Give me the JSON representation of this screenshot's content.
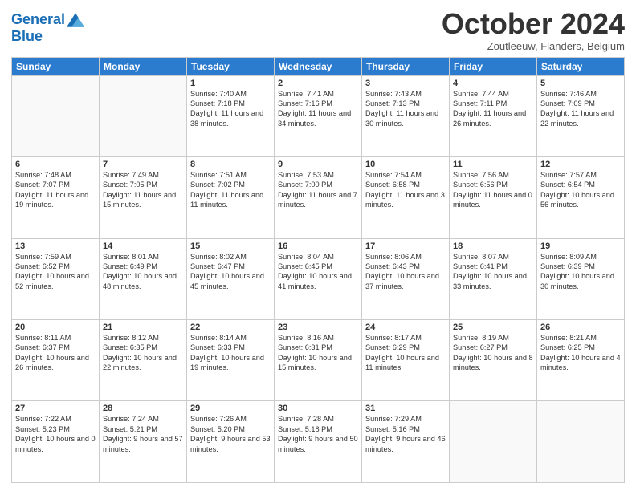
{
  "logo": {
    "line1": "General",
    "line2": "Blue"
  },
  "title": "October 2024",
  "subtitle": "Zoutleeuw, Flanders, Belgium",
  "days_of_week": [
    "Sunday",
    "Monday",
    "Tuesday",
    "Wednesday",
    "Thursday",
    "Friday",
    "Saturday"
  ],
  "weeks": [
    [
      {
        "day": "",
        "info": ""
      },
      {
        "day": "",
        "info": ""
      },
      {
        "day": "1",
        "info": "Sunrise: 7:40 AM\nSunset: 7:18 PM\nDaylight: 11 hours and 38 minutes."
      },
      {
        "day": "2",
        "info": "Sunrise: 7:41 AM\nSunset: 7:16 PM\nDaylight: 11 hours and 34 minutes."
      },
      {
        "day": "3",
        "info": "Sunrise: 7:43 AM\nSunset: 7:13 PM\nDaylight: 11 hours and 30 minutes."
      },
      {
        "day": "4",
        "info": "Sunrise: 7:44 AM\nSunset: 7:11 PM\nDaylight: 11 hours and 26 minutes."
      },
      {
        "day": "5",
        "info": "Sunrise: 7:46 AM\nSunset: 7:09 PM\nDaylight: 11 hours and 22 minutes."
      }
    ],
    [
      {
        "day": "6",
        "info": "Sunrise: 7:48 AM\nSunset: 7:07 PM\nDaylight: 11 hours and 19 minutes."
      },
      {
        "day": "7",
        "info": "Sunrise: 7:49 AM\nSunset: 7:05 PM\nDaylight: 11 hours and 15 minutes."
      },
      {
        "day": "8",
        "info": "Sunrise: 7:51 AM\nSunset: 7:02 PM\nDaylight: 11 hours and 11 minutes."
      },
      {
        "day": "9",
        "info": "Sunrise: 7:53 AM\nSunset: 7:00 PM\nDaylight: 11 hours and 7 minutes."
      },
      {
        "day": "10",
        "info": "Sunrise: 7:54 AM\nSunset: 6:58 PM\nDaylight: 11 hours and 3 minutes."
      },
      {
        "day": "11",
        "info": "Sunrise: 7:56 AM\nSunset: 6:56 PM\nDaylight: 11 hours and 0 minutes."
      },
      {
        "day": "12",
        "info": "Sunrise: 7:57 AM\nSunset: 6:54 PM\nDaylight: 10 hours and 56 minutes."
      }
    ],
    [
      {
        "day": "13",
        "info": "Sunrise: 7:59 AM\nSunset: 6:52 PM\nDaylight: 10 hours and 52 minutes."
      },
      {
        "day": "14",
        "info": "Sunrise: 8:01 AM\nSunset: 6:49 PM\nDaylight: 10 hours and 48 minutes."
      },
      {
        "day": "15",
        "info": "Sunrise: 8:02 AM\nSunset: 6:47 PM\nDaylight: 10 hours and 45 minutes."
      },
      {
        "day": "16",
        "info": "Sunrise: 8:04 AM\nSunset: 6:45 PM\nDaylight: 10 hours and 41 minutes."
      },
      {
        "day": "17",
        "info": "Sunrise: 8:06 AM\nSunset: 6:43 PM\nDaylight: 10 hours and 37 minutes."
      },
      {
        "day": "18",
        "info": "Sunrise: 8:07 AM\nSunset: 6:41 PM\nDaylight: 10 hours and 33 minutes."
      },
      {
        "day": "19",
        "info": "Sunrise: 8:09 AM\nSunset: 6:39 PM\nDaylight: 10 hours and 30 minutes."
      }
    ],
    [
      {
        "day": "20",
        "info": "Sunrise: 8:11 AM\nSunset: 6:37 PM\nDaylight: 10 hours and 26 minutes."
      },
      {
        "day": "21",
        "info": "Sunrise: 8:12 AM\nSunset: 6:35 PM\nDaylight: 10 hours and 22 minutes."
      },
      {
        "day": "22",
        "info": "Sunrise: 8:14 AM\nSunset: 6:33 PM\nDaylight: 10 hours and 19 minutes."
      },
      {
        "day": "23",
        "info": "Sunrise: 8:16 AM\nSunset: 6:31 PM\nDaylight: 10 hours and 15 minutes."
      },
      {
        "day": "24",
        "info": "Sunrise: 8:17 AM\nSunset: 6:29 PM\nDaylight: 10 hours and 11 minutes."
      },
      {
        "day": "25",
        "info": "Sunrise: 8:19 AM\nSunset: 6:27 PM\nDaylight: 10 hours and 8 minutes."
      },
      {
        "day": "26",
        "info": "Sunrise: 8:21 AM\nSunset: 6:25 PM\nDaylight: 10 hours and 4 minutes."
      }
    ],
    [
      {
        "day": "27",
        "info": "Sunrise: 7:22 AM\nSunset: 5:23 PM\nDaylight: 10 hours and 0 minutes."
      },
      {
        "day": "28",
        "info": "Sunrise: 7:24 AM\nSunset: 5:21 PM\nDaylight: 9 hours and 57 minutes."
      },
      {
        "day": "29",
        "info": "Sunrise: 7:26 AM\nSunset: 5:20 PM\nDaylight: 9 hours and 53 minutes."
      },
      {
        "day": "30",
        "info": "Sunrise: 7:28 AM\nSunset: 5:18 PM\nDaylight: 9 hours and 50 minutes."
      },
      {
        "day": "31",
        "info": "Sunrise: 7:29 AM\nSunset: 5:16 PM\nDaylight: 9 hours and 46 minutes."
      },
      {
        "day": "",
        "info": ""
      },
      {
        "day": "",
        "info": ""
      }
    ]
  ]
}
